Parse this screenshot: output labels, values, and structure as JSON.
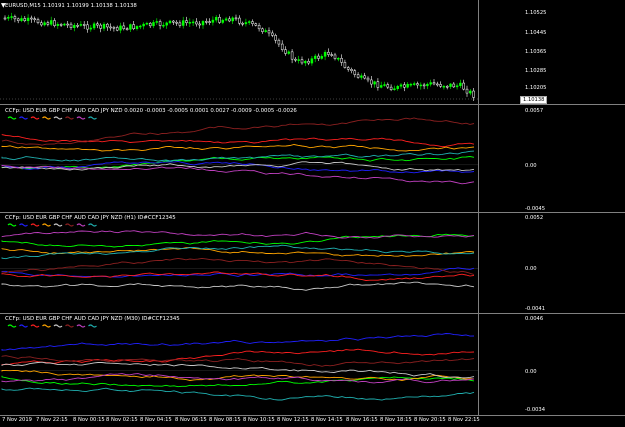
{
  "chart": {
    "symbol_title": "EURUSD,M15  1.10191 1.10199 1.10138 1.10138",
    "price_ticks": [
      "1.10525",
      "1.10445",
      "1.10365",
      "1.10285",
      "1.10205"
    ],
    "current_price": "1.10138",
    "bull_color": "#00ff00",
    "bear_color": "#ffffff"
  },
  "indicators": [
    {
      "title": "CCFp: USD EUR GBP CHF AUD CAD JPY NZD 0.0020 -0.0003 -0.0005 0.0001 0.0027 -0.0009 -0.0005 -0.0026",
      "ticks": [
        "0.0057",
        "0.00",
        "-0.0045"
      ]
    },
    {
      "title": "CCFp: USD EUR GBP CHF AUD CAD JPY NZD (H1) ID#CCF12345",
      "ticks": [
        "0.0052",
        "0.00",
        "-0.0041"
      ]
    },
    {
      "title": "CCFp: USD EUR GBP CHF AUD CAD JPY NZD (M30) ID#CCF12345",
      "ticks": [
        "0.0046",
        "0.00",
        "-0.0034"
      ]
    }
  ],
  "legend_currencies": [
    "USD",
    "EUR",
    "GBP",
    "CHF",
    "AUD",
    "CAD",
    "JPY",
    "NZD"
  ],
  "legend_colors": [
    "#00ff00",
    "#2020ff",
    "#ff2020",
    "#ffa500",
    "#c8c8c8",
    "#8b2020",
    "#c040c0",
    "#20b0b0"
  ],
  "time_axis": [
    "7 Nov 2019",
    "7 Nov 22:15",
    "8 Nov 00:15",
    "8 Nov 02:15",
    "8 Nov 04:15",
    "8 Nov 06:15",
    "8 Nov 08:15",
    "8 Nov 10:15",
    "8 Nov 12:15",
    "8 Nov 14:15",
    "8 Nov 16:15",
    "8 Nov 18:15",
    "8 Nov 20:15",
    "8 Nov 22:15"
  ]
}
